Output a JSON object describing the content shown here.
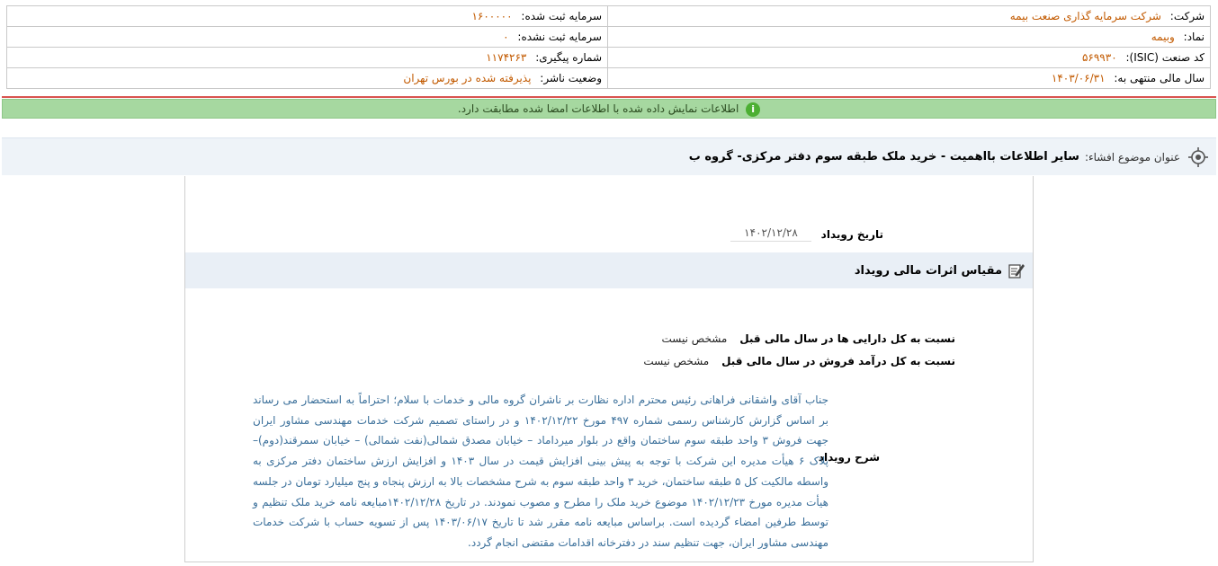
{
  "header": {
    "company_label": "شرکت:",
    "company_value": "شرکت سرمایه گذاری صنعت بیمه",
    "registered_capital_label": "سرمایه ثبت شده:",
    "registered_capital_value": "۱۶۰۰۰۰۰",
    "symbol_label": "نماد:",
    "symbol_value": "وبیمه",
    "unregistered_capital_label": "سرمایه ثبت نشده:",
    "unregistered_capital_value": "۰",
    "isic_label": "کد صنعت (ISIC):",
    "isic_value": "۵۶۹۹۳۰",
    "tracking_label": "شماره پیگیری:",
    "tracking_value": "۱۱۷۴۲۶۳",
    "fiscal_year_label": "سال مالی منتهی به:",
    "fiscal_year_value": "۱۴۰۳/۰۶/۳۱",
    "publisher_status_label": "وضعیت ناشر:",
    "publisher_status_value": "پذیرفته شده در بورس تهران"
  },
  "notice": {
    "text": "اطلاعات نمایش داده شده با اطلاعات امضا شده مطابقت دارد."
  },
  "subject": {
    "label": "عنوان موضوع افشاء:",
    "title": "سایر اطلاعات بااهمیت - خرید ملک طبقه سوم دفتر مرکزی- گروه ب"
  },
  "event": {
    "date_label": "تاریخ رویداد",
    "date_value": "۱۴۰۲/۱۲/۲۸",
    "section_title": "مقیاس اثرات مالی رویداد",
    "assets_ratio_label": "نسبت به کل دارایی ها در سال مالی قبل",
    "assets_ratio_value": "مشخص نیست",
    "revenue_ratio_label": "نسبت به کل درآمد فروش در سال مالی قبل",
    "revenue_ratio_value": "مشخص نیست",
    "description_label": "شرح رویداد",
    "description_text": "جناب آقای واشقانی فراهانی رئیس محترم اداره نظارت بر ناشران گروه مالی و خدمات با سلام؛ احتراماً به استحضار می رساند بر اساس گزارش کارشناس رسمی شماره ۴۹۷ مورخ ۱۴۰۲/۱۲/۲۲ و در راستای تصمیم شرکت خدمات مهندسی مشاور ایران جهت فروش ۳ واحد طبقه سوم ساختمان واقع در بلوار میرداماد – خیابان مصدق شمالی(نفت شمالی) – خیابان سمرقند(دوم)– پلاک ۶ هیأت مدیره این شرکت با توجه به پیش بینی افزایش قیمت در سال ۱۴۰۳ و افزایش ارزش ساختمان دفتر مرکزی به واسطه مالکیت کل ۵ طبقه ساختمان، خرید ۳ واحد طبقه سوم به شرح مشخصات بالا به ارزش پنجاه و پنج میلیارد تومان در جلسه هیأت مدیره مورخ ۱۴۰۲/۱۲/۲۳ موضوع خرید ملک را مطرح و مصوب نمودند. در تاریخ ۱۴۰۲/۱۲/۲۸مبایعه نامه خرید ملک تنظیم و توسط طرفین امضاء گردیده است. براساس مبایعه نامه مقرر شد تا تاریخ ۱۴۰۳/۰۶/۱۷ پس از تسویه حساب با شرکت خدمات مهندسی مشاور ایران، جهت تنظیم سند در دفترخانه اقدامات مقتضی انجام گردد."
  },
  "colors": {
    "value_orange": "#c25a00",
    "notice_green": "#a6d8a0",
    "description_blue": "#3a6f9a",
    "separator_red": "#d9534f"
  }
}
